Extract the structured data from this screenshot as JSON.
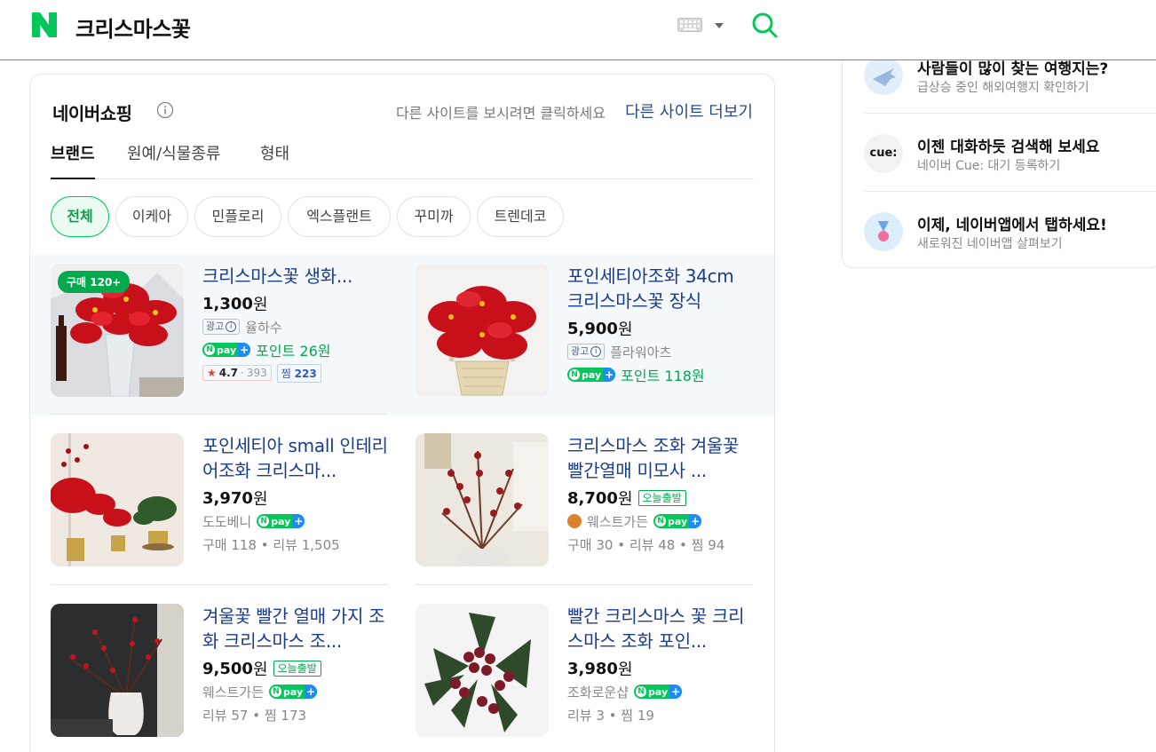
{
  "header": {
    "logo": "N",
    "query": "크리스마스꽃",
    "keyboard_icon": "keyboard-icon",
    "search_icon": "search-icon",
    "brand_color": "#03c75a"
  },
  "shopping": {
    "title": "네이버쇼핑",
    "hint": "다른 사이트를 보시려면 클릭하세요",
    "more": "다른 사이트 더보기",
    "tabs": [
      {
        "label": "브랜드",
        "active": true
      },
      {
        "label": "원예/식물종류",
        "active": false
      },
      {
        "label": "형태",
        "active": false
      }
    ],
    "chips": [
      {
        "label": "전체",
        "active": true
      },
      {
        "label": "이케아",
        "active": false
      },
      {
        "label": "민플로리",
        "active": false
      },
      {
        "label": "엑스플랜트",
        "active": false
      },
      {
        "label": "꾸미까",
        "active": false
      },
      {
        "label": "트렌데코",
        "active": false
      }
    ],
    "products": [
      {
        "title": "크리스마스꽃 생화...",
        "badge": "구매 120+",
        "price": "1,300",
        "won": "원",
        "ad": "광고",
        "seller": "율하수",
        "point": "포인트 26원",
        "rating": "4.7",
        "rating_count": "393",
        "zzim_label": "찜",
        "zzim": "223"
      },
      {
        "title": "포인세티아조화 34cm 크리스마스꽃 장식",
        "price": "5,900",
        "won": "원",
        "ad": "광고",
        "seller": "플라워아츠",
        "point": "포인트 118원"
      },
      {
        "title": "포인세티아 small 인테리어조화 크리스마...",
        "price": "3,970",
        "won": "원",
        "seller": "도도베니",
        "stats": "구매 118 • 리뷰 1,505"
      },
      {
        "title": "크리스마스 조화 겨울꽃 빨간열매 미모사 ...",
        "price": "8,700",
        "won": "원",
        "today": "오늘출발",
        "seller": "웨스트가든",
        "stats": "구매 30 • 리뷰 48 • 찜 94"
      },
      {
        "title": "겨울꽃 빨간 열매 가지 조화 크리스마스 조...",
        "price": "9,500",
        "won": "원",
        "today": "오늘출발",
        "seller": "웨스트가든",
        "stats": "리뷰 57 • 찜 173"
      },
      {
        "title": "빨간 크리스마스 꽃 크리스마스 조화 포인...",
        "price": "3,980",
        "won": "원",
        "seller": "조화로운샵",
        "stats": "리뷰 3 • 찜 19"
      }
    ],
    "npay_label": "pay"
  },
  "side": {
    "items": [
      {
        "title": "사람들이 많이 찾는 여행지는?",
        "sub": "급상승 중인 해외여행지 확인하기",
        "icon": "airplane-icon"
      },
      {
        "title": "이젠 대화하듯 검색해 보세요",
        "sub": "네이버 Cue: 대기 등록하기",
        "icon": "cue-icon",
        "icon_text": "cue:"
      },
      {
        "title": "이제, 네이버앱에서 탭하세요!",
        "sub": "새로워진 네이버앱 살펴보기",
        "icon": "medal-icon"
      }
    ]
  }
}
